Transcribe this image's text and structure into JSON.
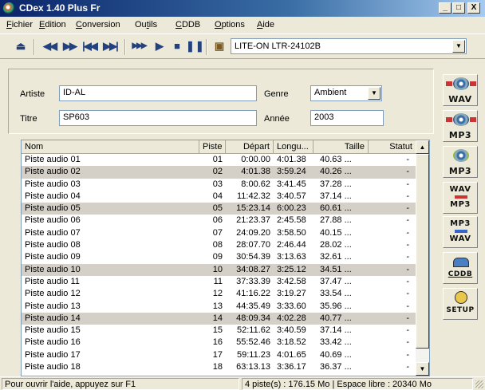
{
  "window": {
    "title": "CDex 1.40 Plus Fr"
  },
  "titlebar_buttons": {
    "minimize": "_",
    "maximize": "□",
    "close": "X"
  },
  "menu": [
    {
      "u": "F",
      "rest": "ichier"
    },
    {
      "u": "E",
      "rest": "dition"
    },
    {
      "u": "C",
      "rest": "onversion"
    },
    {
      "pre": "Ou",
      "u": "t",
      "rest": "ils"
    },
    {
      "u": "C",
      "rest": "DDB"
    },
    {
      "u": "O",
      "rest": "ptions"
    },
    {
      "u": "A",
      "rest": "ide"
    }
  ],
  "toolbar": {
    "icons": [
      "eject-icon",
      "rewind-icon",
      "fast-forward-icon",
      "previous-track-icon",
      "next-track-icon",
      "skip-icon",
      "play-icon",
      "stop-icon",
      "pause-icon",
      "cd-info-icon"
    ],
    "drive": "LITE-ON LTR-24102B"
  },
  "form": {
    "artist_label": "Artiste",
    "artist_value": "ID-AL",
    "title_label": "Titre",
    "title_value": "SP603",
    "genre_label": "Genre",
    "genre_value": "Ambient",
    "year_label": "Année",
    "year_value": "2003"
  },
  "table": {
    "headers": {
      "name": "Nom",
      "track": "Piste",
      "start": "Départ",
      "length": "Longu...",
      "size": "Taille",
      "status": "Statut"
    },
    "rows": [
      {
        "name": "Piste audio 01",
        "track": "01",
        "start": "0:00.00",
        "length": "4:01.38",
        "size": "40.63 ...",
        "status": "-",
        "sel": false
      },
      {
        "name": "Piste audio 02",
        "track": "02",
        "start": "4:01.38",
        "length": "3:59.24",
        "size": "40.26 ...",
        "status": "-",
        "sel": true
      },
      {
        "name": "Piste audio 03",
        "track": "03",
        "start": "8:00.62",
        "length": "3:41.45",
        "size": "37.28 ...",
        "status": "-",
        "sel": false
      },
      {
        "name": "Piste audio 04",
        "track": "04",
        "start": "11:42.32",
        "length": "3:40.57",
        "size": "37.14 ...",
        "status": "-",
        "sel": false
      },
      {
        "name": "Piste audio 05",
        "track": "05",
        "start": "15:23.14",
        "length": "6:00.23",
        "size": "60.61 ...",
        "status": "-",
        "sel": true
      },
      {
        "name": "Piste audio 06",
        "track": "06",
        "start": "21:23.37",
        "length": "2:45.58",
        "size": "27.88 ...",
        "status": "-",
        "sel": false
      },
      {
        "name": "Piste audio 07",
        "track": "07",
        "start": "24:09.20",
        "length": "3:58.50",
        "size": "40.15 ...",
        "status": "-",
        "sel": false
      },
      {
        "name": "Piste audio 08",
        "track": "08",
        "start": "28:07.70",
        "length": "2:46.44",
        "size": "28.02 ...",
        "status": "-",
        "sel": false
      },
      {
        "name": "Piste audio 09",
        "track": "09",
        "start": "30:54.39",
        "length": "3:13.63",
        "size": "32.61 ...",
        "status": "-",
        "sel": false
      },
      {
        "name": "Piste audio 10",
        "track": "10",
        "start": "34:08.27",
        "length": "3:25.12",
        "size": "34.51 ...",
        "status": "-",
        "sel": true
      },
      {
        "name": "Piste audio 11",
        "track": "11",
        "start": "37:33.39",
        "length": "3:42.58",
        "size": "37.47 ...",
        "status": "-",
        "sel": false
      },
      {
        "name": "Piste audio 12",
        "track": "12",
        "start": "41:16.22",
        "length": "3:19.27",
        "size": "33.54 ...",
        "status": "-",
        "sel": false
      },
      {
        "name": "Piste audio 13",
        "track": "13",
        "start": "44:35.49",
        "length": "3:33.60",
        "size": "35.96 ...",
        "status": "-",
        "sel": false
      },
      {
        "name": "Piste audio 14",
        "track": "14",
        "start": "48:09.34",
        "length": "4:02.28",
        "size": "40.77 ...",
        "status": "-",
        "sel": true
      },
      {
        "name": "Piste audio 15",
        "track": "15",
        "start": "52:11.62",
        "length": "3:40.59",
        "size": "37.14 ...",
        "status": "-",
        "sel": false
      },
      {
        "name": "Piste audio 16",
        "track": "16",
        "start": "55:52.46",
        "length": "3:18.52",
        "size": "33.42 ...",
        "status": "-",
        "sel": false
      },
      {
        "name": "Piste audio 17",
        "track": "17",
        "start": "59:11.23",
        "length": "4:01.65",
        "size": "40.69 ...",
        "status": "-",
        "sel": false
      },
      {
        "name": "Piste audio 18",
        "track": "18",
        "start": "63:13.13",
        "length": "3:36.17",
        "size": "36.37 ...",
        "status": "-",
        "sel": false
      }
    ]
  },
  "side_buttons": [
    {
      "name": "cd-to-wav-button",
      "label": "WAV"
    },
    {
      "name": "cd-to-mp3-button",
      "label": "MP3"
    },
    {
      "name": "wav-to-mp3-button",
      "label": "MP3"
    },
    {
      "name": "wav-mp3-convert-button",
      "top": "WAV",
      "bottom": "MP3"
    },
    {
      "name": "mp3-wav-convert-button",
      "top": "MP3",
      "bottom": "WAV"
    },
    {
      "name": "cddb-button",
      "label": "CDDB"
    },
    {
      "name": "setup-button",
      "label": "SETUP"
    }
  ],
  "status": {
    "help": "Pour ouvrir l'aide, appuyez sur F1",
    "info": "4 piste(s) : 176.15 Mo | Espace libre : 20340 Mo"
  }
}
